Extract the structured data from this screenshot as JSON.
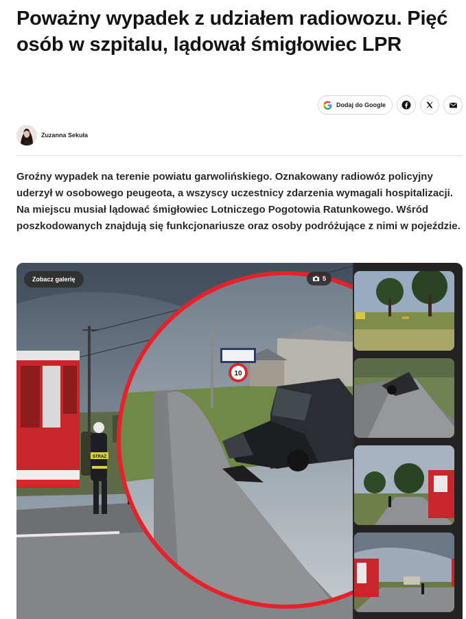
{
  "article": {
    "title": "Poważny wypadek z udziałem radiowozu. Pięć osób w szpitalu, lądował śmigłowiec LPR",
    "author": "Zuzanna Sekuła",
    "lead": "Groźny wypadek na terenie powiatu garwolińskiego. Oznakowany radiowóz policyjny uderzył w osobowego peugeota, a wszyscy uczestnicy zdarzenia wymagali hospitalizacji. Na miejscu musiał lądować śmigłowiec Lotniczego Pogotowia Ratunkowego. Wśród poszkodowanych znajdują się funkcjonariusze oraz osoby podróżujące z nimi w pojeździe."
  },
  "share": {
    "google_label": "Dodaj do Google",
    "icons": [
      "facebook-icon",
      "x-icon",
      "mail-icon"
    ]
  },
  "gallery": {
    "button_label": "Zobacz galerię",
    "photo_count": "5",
    "main_photo_signs": {
      "speed_limit": "10",
      "truck_label": "STRAŻ"
    }
  },
  "colors": {
    "text": "#141414",
    "highlight_ring": "#e8202a",
    "gallery_bg": "#232323"
  }
}
